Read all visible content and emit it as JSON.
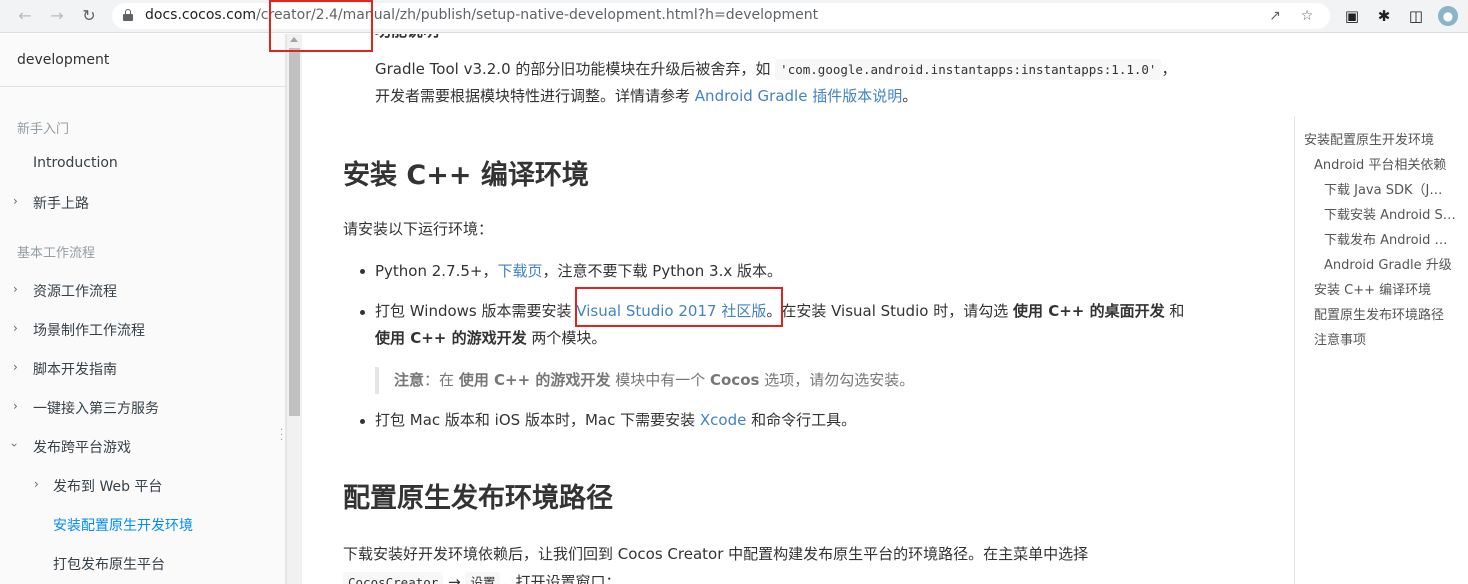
{
  "browser": {
    "url_host": "docs.cocos.com",
    "url_path": "/creator/2.4/manual/zh/publish/setup-native-development.html?h=development",
    "icons": [
      "back-arrow-icon",
      "forward-arrow-icon",
      "reload-icon",
      "lock-icon",
      "share-icon",
      "bookmark-star-icon",
      "extension-icon",
      "puzzle-icon",
      "sidebar-icon",
      "profile-avatar-icon"
    ],
    "colors": {
      "toolbar": "#f1f3f4",
      "annotation": "#e0261a"
    }
  },
  "sidebar": {
    "search_text": "development",
    "sections": [
      {
        "header": "新手入门",
        "items": [
          {
            "label": "Introduction",
            "expandable": false
          },
          {
            "label": "新手上路",
            "expandable": true
          }
        ]
      },
      {
        "header": "基本工作流程",
        "items": [
          {
            "label": "资源工作流程",
            "expandable": true
          },
          {
            "label": "场景制作工作流程",
            "expandable": true
          },
          {
            "label": "脚本开发指南",
            "expandable": true
          },
          {
            "label": "一键接入第三方服务",
            "expandable": true
          },
          {
            "label": "发布跨平台游戏",
            "expandable": true,
            "expanded": true
          }
        ]
      }
    ],
    "subitems": [
      {
        "label": "发布到 Web 平台",
        "expandable": true
      },
      {
        "label": "安装配置原生开发环境",
        "active": true
      },
      {
        "label": "打包发布原生平台"
      }
    ],
    "active_color": "#008cff"
  },
  "content": {
    "partial_heading": "功能说明",
    "gradle_p1_a": "Gradle Tool v3.2.0 的部分旧功能模块在升级后被舍弃，如",
    "gradle_code": "'com.google.android.instantapps:instantapps:1.1.0'",
    "gradle_p1_b": "，",
    "gradle_p2_a": "开发者需要根据模块特性进行调整。详情请参考",
    "gradle_link": "Android Gradle 插件版本说明",
    "gradle_p2_b": "。",
    "h2_cpp": "安装 C++ 编译环境",
    "intro": "请安装以下运行环境：",
    "b1_a": "Python 2.7.5+，",
    "b1_link": "下载页",
    "b1_b": "，注意不要下载 Python 3.x 版本。",
    "b2_a": "打包 Windows 版本需要安装",
    "b2_link": "Visual Studio 2017 社区版",
    "b2_b": "。在安装 Visual Studio 时，请勾选",
    "b2_bold1": "使用 C++ 的桌面开发",
    "b2_c": "和",
    "b2_bold2": "使用 C++ 的游戏开发",
    "b2_d": "两个模块。",
    "note_label": "注意",
    "note_a": "：在",
    "note_bold": "使用 C++ 的游戏开发",
    "note_b": "模块中有一个",
    "note_bold2": "Cocos",
    "note_c": "选项，请勿勾选安装。",
    "b3_a": "打包 Mac 版本和 iOS 版本时，Mac 下需要安装",
    "b3_link": "Xcode",
    "b3_b": "和命令行工具。",
    "h2_path": "配置原生发布环境路径",
    "path_p": "下载安装好开发环境依赖后，让我们回到 Cocos Creator 中配置构建发布原生平台的环境路径。在主菜单中选择",
    "path_code1": "CocosCreator",
    "path_code2": "设置",
    "path_tail": "，打开设置窗口："
  },
  "toc": {
    "items": [
      {
        "label": "安装配置原生开发环境",
        "level": 1
      },
      {
        "label": "Android 平台相关依赖",
        "level": 2
      },
      {
        "label": "下载 Java SDK（J…",
        "level": 3
      },
      {
        "label": "下载安装 Android S…",
        "level": 3
      },
      {
        "label": "下载发布 Android …",
        "level": 3
      },
      {
        "label": "Android Gradle 升级",
        "level": 3
      },
      {
        "label": "安装 C++ 编译环境",
        "level": 2
      },
      {
        "label": "配置原生发布环境路径",
        "level": 2
      },
      {
        "label": "注意事项",
        "level": 2
      }
    ]
  }
}
